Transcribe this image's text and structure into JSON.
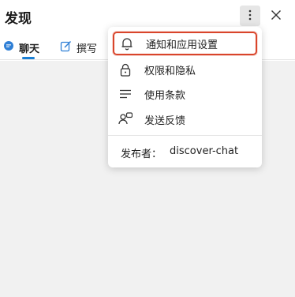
{
  "header": {
    "title": "发现"
  },
  "tabs": [
    {
      "label": "聊天",
      "icon": "chat-bubble-icon"
    },
    {
      "label": "撰写",
      "icon": "edit-icon"
    }
  ],
  "menu": {
    "items": [
      {
        "label": "通知和应用设置",
        "icon": "bell-icon",
        "highlighted": true
      },
      {
        "label": "权限和隐私",
        "icon": "lock-icon"
      },
      {
        "label": "使用条款",
        "icon": "list-icon"
      },
      {
        "label": "发送反馈",
        "icon": "feedback-icon"
      }
    ],
    "publisher_label": "发布者：",
    "publisher_value": "discover-chat"
  },
  "colors": {
    "accent": "#1a7fd4",
    "highlight_border": "#d9452b",
    "body_background": "#f1f1f1"
  }
}
